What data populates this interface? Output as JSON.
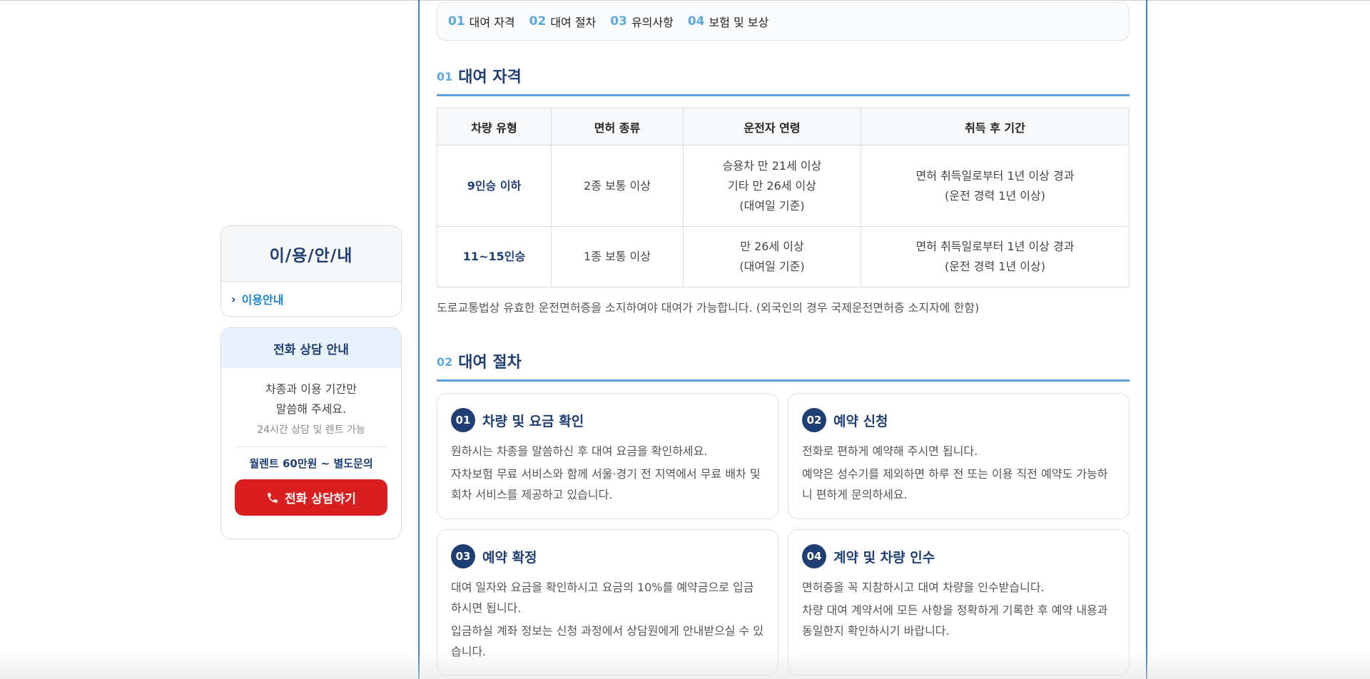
{
  "sidebar": {
    "guide_title": "이/용/안/내",
    "guide_item": "이용안내",
    "phone_title": "전화 상담 안내",
    "phone_desc": [
      "차종과 이용 기간만",
      "말씀해 주세요."
    ],
    "phone_sub": "24시간 상담 및 렌트 가능",
    "phone_price": "월렌트 60만원 ~ 별도문의",
    "phone_button": "전화 상담하기"
  },
  "toc": [
    {
      "num": "01",
      "label": "대여 자격"
    },
    {
      "num": "02",
      "label": "대여 절차"
    },
    {
      "num": "03",
      "label": "유의사항"
    },
    {
      "num": "04",
      "label": "보험 및 보상"
    }
  ],
  "section1": {
    "num": "01",
    "title": "대여 자격",
    "table": {
      "headers": [
        "차량 유형",
        "면허 종류",
        "운전자 연령",
        "취득 후 기간"
      ],
      "rows": [
        {
          "vehicle": "9인승 이하",
          "license": "2종 보통 이상",
          "age": [
            "승용차 만 21세 이상",
            "기타 만 26세 이상",
            "(대여일 기준)"
          ],
          "period": [
            "면허 취득일로부터 1년 이상 경과",
            "(운전 경력 1년 이상)"
          ]
        },
        {
          "vehicle": "11~15인승",
          "license": "1종 보통 이상",
          "age": [
            "만 26세 이상",
            "(대여일 기준)"
          ],
          "period": [
            "면허 취득일로부터 1년 이상 경과",
            "(운전 경력 1년 이상)"
          ]
        }
      ]
    },
    "note": "도로교통법상 유효한 운전면허증을 소지하여야 대여가 가능합니다. (외국인의 경우 국제운전면허증 소지자에 한함)"
  },
  "section2": {
    "num": "02",
    "title": "대여 절차",
    "steps": [
      {
        "num": "01",
        "title": "차량 및 요금 확인",
        "lines": [
          "원하시는 차종을 말씀하신 후 대여 요금을 확인하세요.",
          "자차보험 무료 서비스와 함께 서울·경기 전 지역에서 무료 배차 및 회차 서비스를 제공하고 있습니다."
        ]
      },
      {
        "num": "02",
        "title": "예약 신청",
        "lines": [
          "전화로 편하게 예약해 주시면 됩니다.",
          "예약은 성수기를 제외하면 하루 전 또는 이용 직전 예약도 가능하니 편하게 문의하세요."
        ]
      },
      {
        "num": "03",
        "title": "예약 확정",
        "lines": [
          "대여 일자와 요금을 확인하시고 요금의 10%를 예약금으로 입금하시면 됩니다.",
          "입금하실 계좌 정보는 신청 과정에서 상담원에게 안내받으실 수 있습니다."
        ]
      },
      {
        "num": "04",
        "title": "계약 및 차량 인수",
        "lines": [
          "면허증을 꼭 지참하시고 대여 차량을 인수받습니다.",
          "차량 대여 계약서에 모든 사항을 정확하게 기록한 후 예약 내용과 동일한지 확인하시기 바랍니다."
        ]
      }
    ]
  }
}
